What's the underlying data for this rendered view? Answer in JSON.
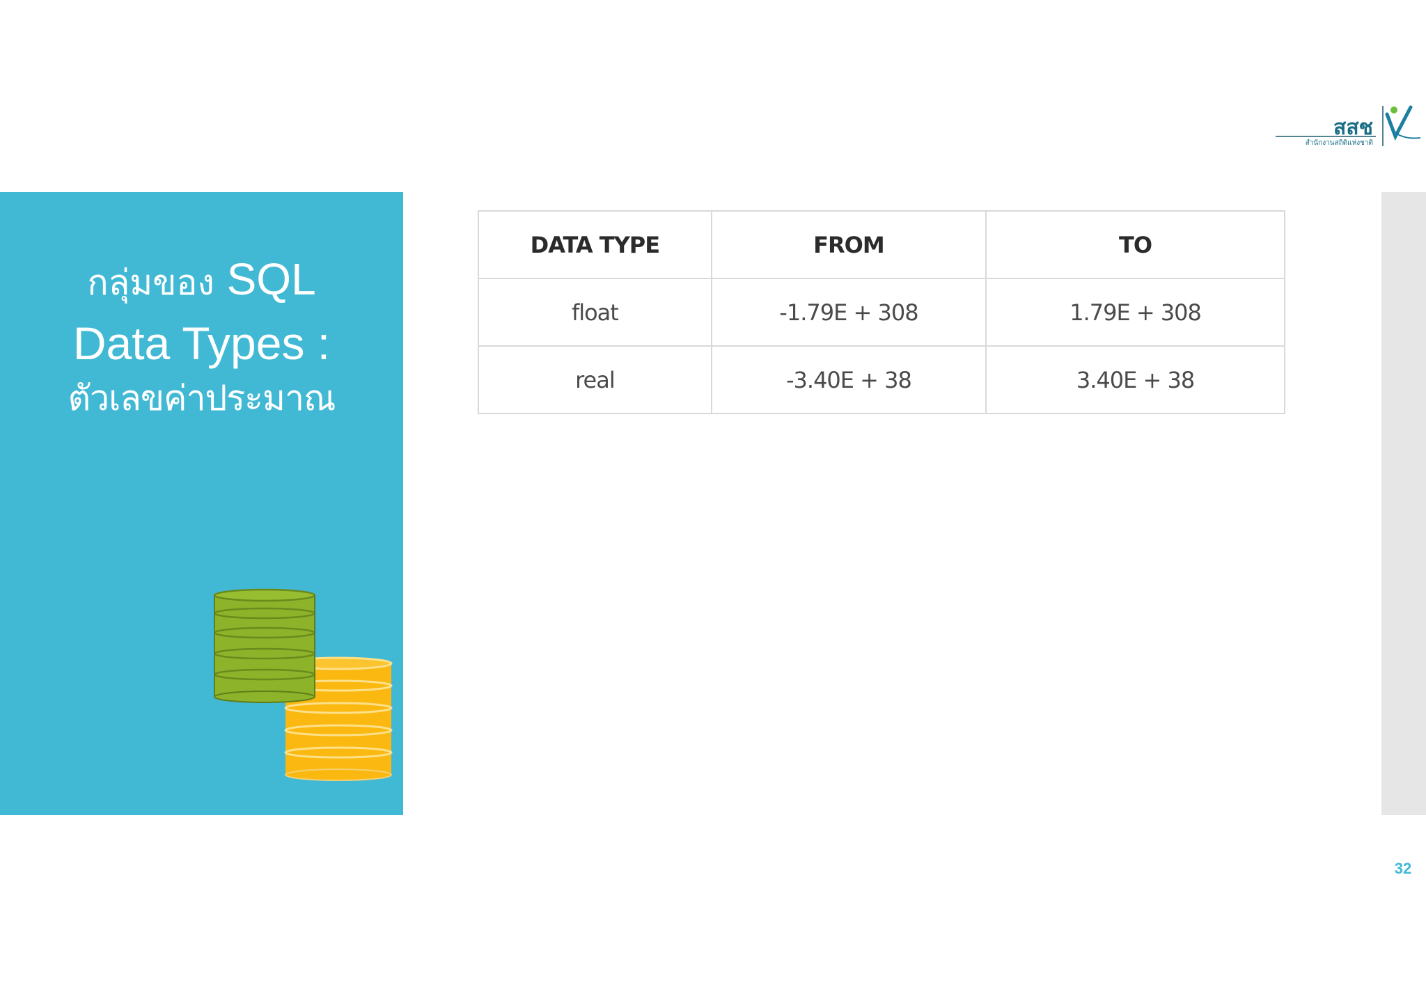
{
  "slide": {
    "title_thai_prefix": "กลุ่มของ",
    "title_sql": "SQL",
    "title_line2": "Data Types :",
    "title_line3": "ตัวเลขค่าประมาณ",
    "page_number": "32"
  },
  "logo": {
    "text": "สสช",
    "subtext": "สำนักงานสถิติแห่งชาติ"
  },
  "table": {
    "headers": [
      "DATA TYPE",
      "FROM",
      "TO"
    ],
    "rows": [
      [
        "float",
        "-1.79E + 308",
        "1.79E + 308"
      ],
      [
        "real",
        "-3.40E + 38",
        "3.40E + 38"
      ]
    ]
  },
  "colors": {
    "panel": "#42b9d4",
    "side_bar": "#e6e6e6",
    "db_green": "#8db32a",
    "db_yellow": "#fbb810",
    "logo_teal": "#1a8fa3"
  },
  "icons": {
    "database": "database-stack-icon",
    "logo": "nso-logo"
  }
}
